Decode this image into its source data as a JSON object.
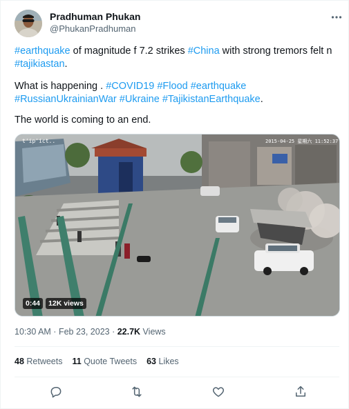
{
  "author": {
    "name": "Pradhuman Phukan",
    "handle": "@PhukanPradhuman"
  },
  "tweet": {
    "line1": {
      "tag1": "#earthquake",
      "text1": " of magnitude f 7.2 strikes ",
      "tag2": "#China",
      "text2": " with strong tremors felt n ",
      "tag3": "#tajikiastan",
      "text3": "."
    },
    "line2": {
      "text1": "What is happening . ",
      "tag1": "#COVID19",
      "tag2": "#Flood",
      "tag3": "#earthquake",
      "tag4": "#RussianUkrainianWar",
      "tag5": "#Ukraine",
      "tag6": "#TajikistanEarthquake",
      "text2": "."
    },
    "line3": "The world is coming to an end."
  },
  "video": {
    "duration": "0:44",
    "views": "12K views",
    "overlay_timestamp": "2015-04-25 星期六 11:52:37",
    "overlay_channel": "t'ip'ict.."
  },
  "meta": {
    "time": "10:30 AM",
    "separator": " · ",
    "date": "Feb 23, 2023",
    "views_count": "22.7K",
    "views_label": " Views"
  },
  "stats": {
    "retweets_count": "48",
    "retweets_label": " Retweets",
    "quotes_count": "11",
    "quotes_label": " Quote Tweets",
    "likes_count": "63",
    "likes_label": " Likes"
  },
  "icons": {
    "more": "more-dots-icon",
    "reply": "reply-icon",
    "retweet": "retweet-icon",
    "like": "like-icon",
    "share": "share-icon"
  },
  "colors": {
    "accent": "#1d9bf0",
    "text": "#0f1419",
    "muted": "#536471"
  }
}
